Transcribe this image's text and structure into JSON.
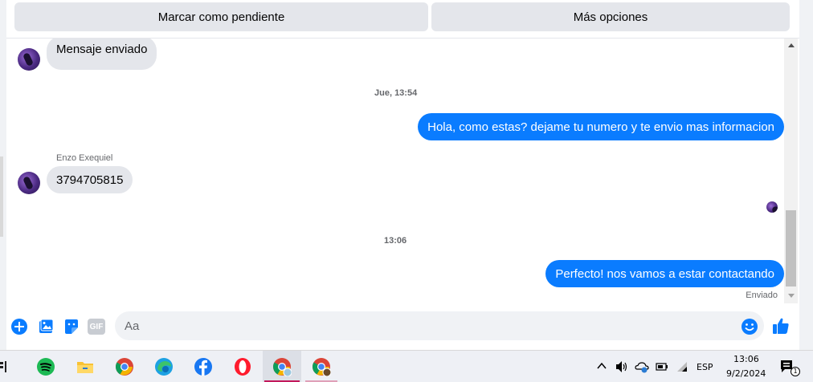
{
  "header": {
    "mark_pending_label": "Marcar como pendiente",
    "more_options_label": "Más opciones"
  },
  "thread": {
    "messages": [
      {
        "type": "incoming",
        "text": "Mensaje enviado"
      },
      {
        "type": "timestamp",
        "text": "Jue, 13:54"
      },
      {
        "type": "outgoing",
        "text": "Hola, como estas? dejame tu numero y te envio mas informacion"
      },
      {
        "type": "incoming",
        "sender": "Enzo Exequiel",
        "text": "3794705815"
      },
      {
        "type": "timestamp",
        "text": "13:06"
      },
      {
        "type": "outgoing",
        "text": "Perfecto! nos vamos a estar contactando",
        "status": "Enviado"
      }
    ]
  },
  "composer": {
    "placeholder": "Aa",
    "icons": [
      "plus-circle-icon",
      "photo-icon",
      "sticker-icon",
      "gif-icon",
      "emoji-icon",
      "thumbs-up-icon"
    ],
    "gif_label": "GIF"
  },
  "taskbar": {
    "apps": [
      "taskview-icon",
      "spotify-icon",
      "file-explorer-icon",
      "chrome-icon",
      "edge-icon",
      "facebook-icon",
      "opera-icon",
      "chrome-profile-icon",
      "chrome-profile-2-icon"
    ],
    "language": "ESP",
    "time": "13:06",
    "date": "9/2/2024",
    "notification_count": "1"
  },
  "colors": {
    "accent": "#0a7cff",
    "bubble_in": "#e4e6eb",
    "button_bg": "#e4e6eb"
  }
}
